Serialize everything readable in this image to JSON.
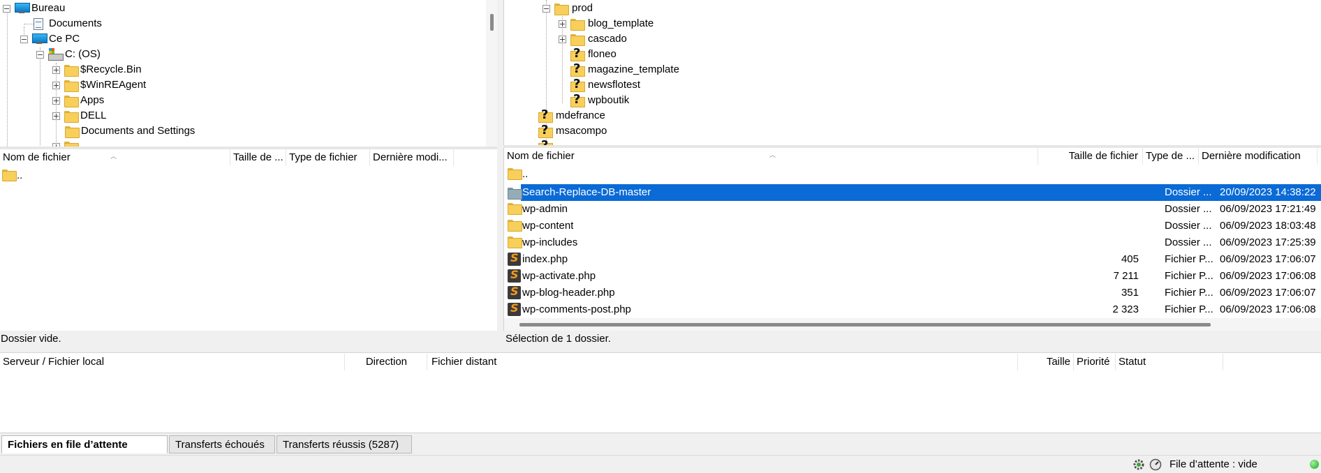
{
  "local_tree": {
    "items": [
      {
        "label": "Bureau"
      },
      {
        "label": "Documents"
      },
      {
        "label": "Ce PC"
      },
      {
        "label": "C: (OS)"
      },
      {
        "label": "$Recycle.Bin"
      },
      {
        "label": "$WinREAgent"
      },
      {
        "label": "Apps"
      },
      {
        "label": "DELL"
      },
      {
        "label": "Documents and Settings"
      }
    ]
  },
  "remote_tree": {
    "items": [
      {
        "label": "prod"
      },
      {
        "label": "blog_template"
      },
      {
        "label": "cascado"
      },
      {
        "label": "floneo"
      },
      {
        "label": "magazine_template"
      },
      {
        "label": "newsflotest"
      },
      {
        "label": "wpboutik"
      },
      {
        "label": "mdefrance"
      },
      {
        "label": "msacompo"
      }
    ]
  },
  "local_list": {
    "columns": [
      "Nom de fichier",
      "Taille de ...",
      "Type de fichier",
      "Dernière modi..."
    ],
    "rows": [
      {
        "name": ".."
      }
    ],
    "status": "Dossier vide."
  },
  "remote_list": {
    "columns": [
      "Nom de fichier",
      "Taille de fichier",
      "Type de ...",
      "Dernière modification"
    ],
    "rows": [
      {
        "name": "..",
        "size": "",
        "type": "",
        "modified": ""
      },
      {
        "name": "Search-Replace-DB-master",
        "size": "",
        "type": "Dossier ...",
        "modified": "20/09/2023 14:38:22"
      },
      {
        "name": "wp-admin",
        "size": "",
        "type": "Dossier ...",
        "modified": "06/09/2023 17:21:49"
      },
      {
        "name": "wp-content",
        "size": "",
        "type": "Dossier ...",
        "modified": "06/09/2023 18:03:48"
      },
      {
        "name": "wp-includes",
        "size": "",
        "type": "Dossier ...",
        "modified": "06/09/2023 17:25:39"
      },
      {
        "name": "index.php",
        "size": "405",
        "type": "Fichier P...",
        "modified": "06/09/2023 17:06:07"
      },
      {
        "name": "wp-activate.php",
        "size": "7 211",
        "type": "Fichier P...",
        "modified": "06/09/2023 17:06:08"
      },
      {
        "name": "wp-blog-header.php",
        "size": "351",
        "type": "Fichier P...",
        "modified": "06/09/2023 17:06:07"
      },
      {
        "name": "wp-comments-post.php",
        "size": "2 323",
        "type": "Fichier P...",
        "modified": "06/09/2023 17:06:08"
      }
    ],
    "status": "Sélection de 1 dossier."
  },
  "queue": {
    "columns": [
      "Serveur / Fichier local",
      "Direction",
      "Fichier distant",
      "Taille",
      "Priorité",
      "Statut"
    ]
  },
  "tabs": [
    {
      "label": "Fichiers en file d’attente"
    },
    {
      "label": "Transferts échoués"
    },
    {
      "label": "Transferts réussis (5287)"
    }
  ],
  "statusbar": {
    "queue_text": "File d’attente : vide"
  },
  "colors": {
    "selection": "#0a6ad6",
    "folder": "#f7cf5a",
    "status_ok": "#2ecc40"
  }
}
